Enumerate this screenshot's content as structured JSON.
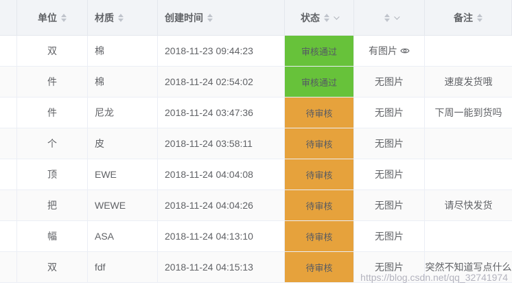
{
  "columns": {
    "unit": "单位",
    "material": "材质",
    "created_time": "创建时间",
    "status": "状态",
    "image": "",
    "remark": "备注"
  },
  "rows": [
    {
      "unit": "双",
      "material": "棉",
      "time": "2018-11-23 09:44:23",
      "status": "审核通过",
      "status_color": "#67c23a",
      "image": "有图片",
      "has_eye": true,
      "remark": ""
    },
    {
      "unit": "件",
      "material": "棉",
      "time": "2018-11-24 02:54:02",
      "status": "审核通过",
      "status_color": "#67c23a",
      "image": "无图片",
      "has_eye": false,
      "remark": "速度发货哦"
    },
    {
      "unit": "件",
      "material": "尼龙",
      "time": "2018-11-24 03:47:36",
      "status": "待审核",
      "status_color": "#e6a23c",
      "image": "无图片",
      "has_eye": false,
      "remark": "下周一能到货吗"
    },
    {
      "unit": "个",
      "material": "皮",
      "time": "2018-11-24 03:58:11",
      "status": "待审核",
      "status_color": "#e6a23c",
      "image": "无图片",
      "has_eye": false,
      "remark": ""
    },
    {
      "unit": "顶",
      "material": "EWE",
      "time": "2018-11-24 04:04:08",
      "status": "待审核",
      "status_color": "#e6a23c",
      "image": "无图片",
      "has_eye": false,
      "remark": ""
    },
    {
      "unit": "把",
      "material": "WEWE",
      "time": "2018-11-24 04:04:26",
      "status": "待审核",
      "status_color": "#e6a23c",
      "image": "无图片",
      "has_eye": false,
      "remark": "请尽快发货"
    },
    {
      "unit": "幅",
      "material": "ASA",
      "time": "2018-11-24 04:13:10",
      "status": "待审核",
      "status_color": "#e6a23c",
      "image": "无图片",
      "has_eye": false,
      "remark": ""
    },
    {
      "unit": "双",
      "material": "fdf",
      "time": "2018-11-24 04:15:13",
      "status": "待审核",
      "status_color": "#e6a23c",
      "image": "无图片",
      "has_eye": false,
      "remark": "突然不知道写点什么"
    }
  ],
  "watermark": "https://blog.csdn.net/qq_32741974"
}
